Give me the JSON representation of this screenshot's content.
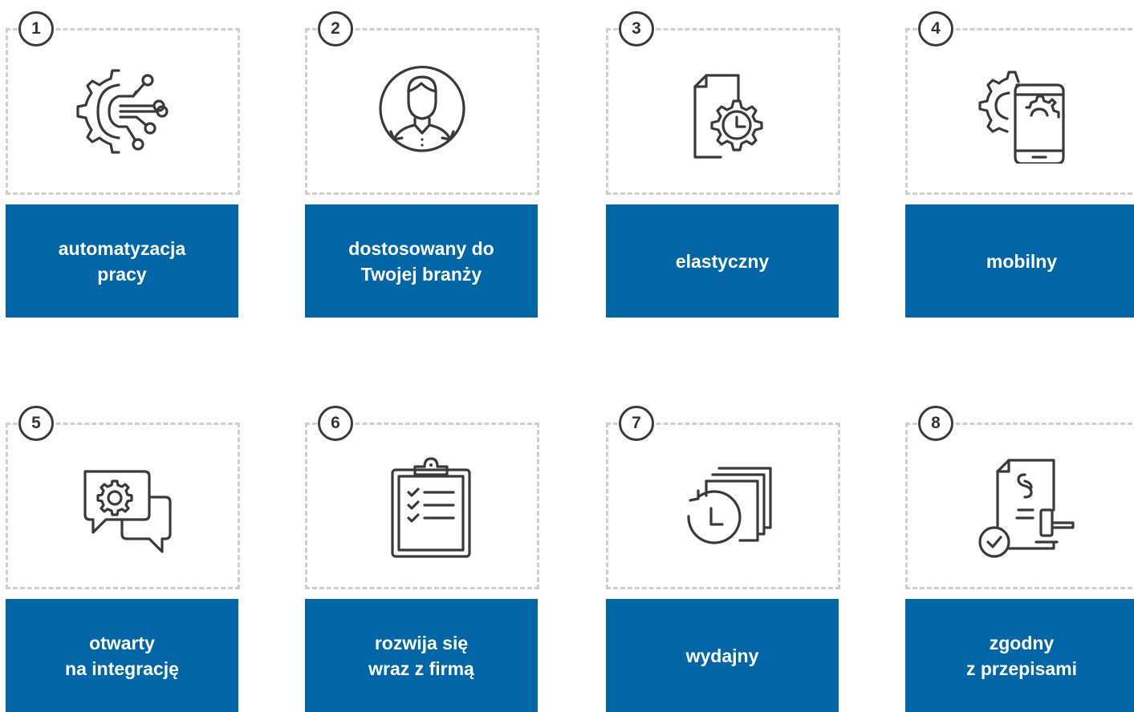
{
  "features": [
    {
      "number": "1",
      "label": "automatyzacja\npracy",
      "icon": "gear-circuit-icon"
    },
    {
      "number": "2",
      "label": "dostosowany do\nTwojej branży",
      "icon": "person-cycle-icon"
    },
    {
      "number": "3",
      "label": "elastyczny",
      "icon": "document-gear-clock-icon"
    },
    {
      "number": "4",
      "label": "mobilny",
      "icon": "gear-smartphone-icon"
    },
    {
      "number": "5",
      "label": "otwarty\nna integrację",
      "icon": "chat-gear-icon"
    },
    {
      "number": "6",
      "label": "rozwija się\nwraz z firmą",
      "icon": "clipboard-checklist-icon"
    },
    {
      "number": "7",
      "label": "wydajny",
      "icon": "documents-history-icon"
    },
    {
      "number": "8",
      "label": "zgodny\nz przepisami",
      "icon": "law-document-gavel-icon"
    }
  ],
  "colors": {
    "accent": "#0066a6",
    "dash": "#cfcfcf",
    "icon": "#3a3a3a"
  }
}
